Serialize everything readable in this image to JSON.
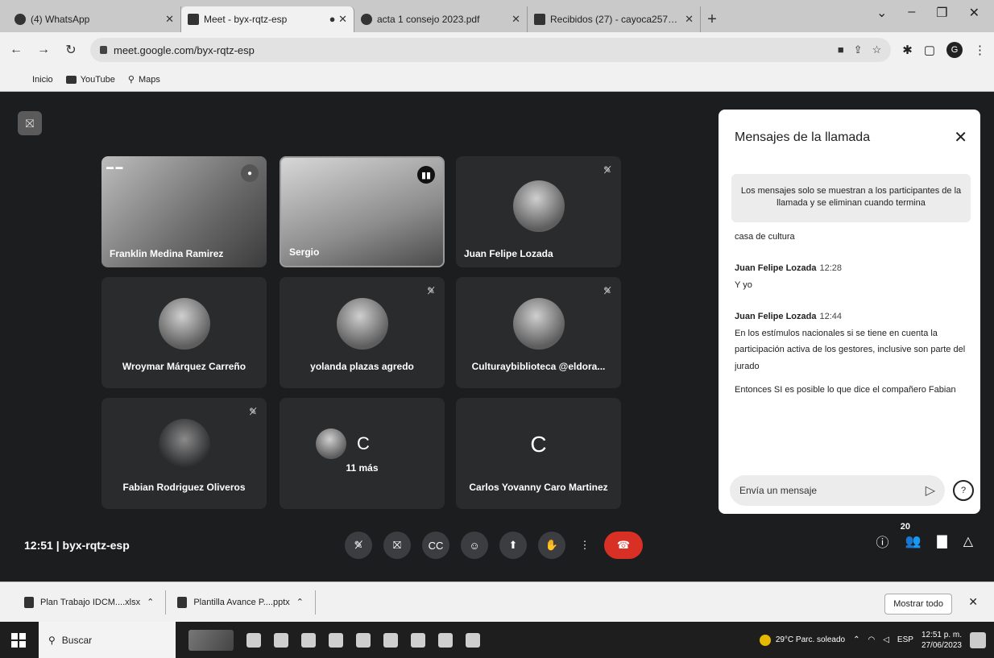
{
  "tabs": [
    {
      "title": "(4) WhatsApp",
      "active": false
    },
    {
      "title": "Meet - byx-rqtz-esp",
      "active": true
    },
    {
      "title": "acta 1 consejo 2023.pdf",
      "active": false
    },
    {
      "title": "Recibidos (27) - cayoca2570@gm",
      "active": false
    }
  ],
  "address": {
    "url": "meet.google.com/byx-rqtz-esp"
  },
  "bookmarks": [
    "Inicio",
    "YouTube",
    "Maps"
  ],
  "tiles": [
    {
      "name": "Franklin Medina Ramirez",
      "kind": "video"
    },
    {
      "name": "Sergio",
      "kind": "video"
    },
    {
      "name": "Juan Felipe Lozada",
      "kind": "camera-off"
    },
    {
      "name": "Wroymar Márquez Carreño",
      "kind": "avatar"
    },
    {
      "name": "yolanda plazas agredo",
      "kind": "avatar"
    },
    {
      "name": "Culturaybiblioteca @eldora...",
      "kind": "avatar"
    },
    {
      "name": "Fabian Rodriguez Oliveros",
      "kind": "camera-off"
    },
    {
      "name": "11 más",
      "kind": "more",
      "letter": "C"
    },
    {
      "name": "Carlos Yovanny Caro Martinez",
      "kind": "letter",
      "letter": "C"
    }
  ],
  "meeting": {
    "time": "12:51",
    "code": "byx-rqtz-esp",
    "participants": "20"
  },
  "chat": {
    "title": "Mensajes de la llamada",
    "notice": "Los mensajes solo se muestran a los participantes de la llamada y se eliminan cuando termina",
    "partial": "casa de cultura",
    "messages": [
      {
        "sender": "Juan Felipe Lozada",
        "time": "12:28",
        "lines": [
          "Y yo"
        ]
      },
      {
        "sender": "Juan Felipe Lozada",
        "time": "12:44",
        "lines": [
          "En los estímulos nacionales si se tiene en cuenta la participación activa de los gestores, inclusive son parte del jurado",
          "Entonces SI es posible lo que dice el compañero Fabian"
        ]
      }
    ],
    "input_placeholder": "Envía un mensaje"
  },
  "downloads": {
    "items": [
      "Plan Trabajo IDCM....xlsx",
      "Plantilla Avance P....pptx"
    ],
    "show_all": "Mostrar todo"
  },
  "taskbar": {
    "search": "Buscar",
    "weather": "29°C Parc. soleado",
    "lang": "ESP",
    "time": "12:51 p. m.",
    "date": "27/06/2023"
  }
}
